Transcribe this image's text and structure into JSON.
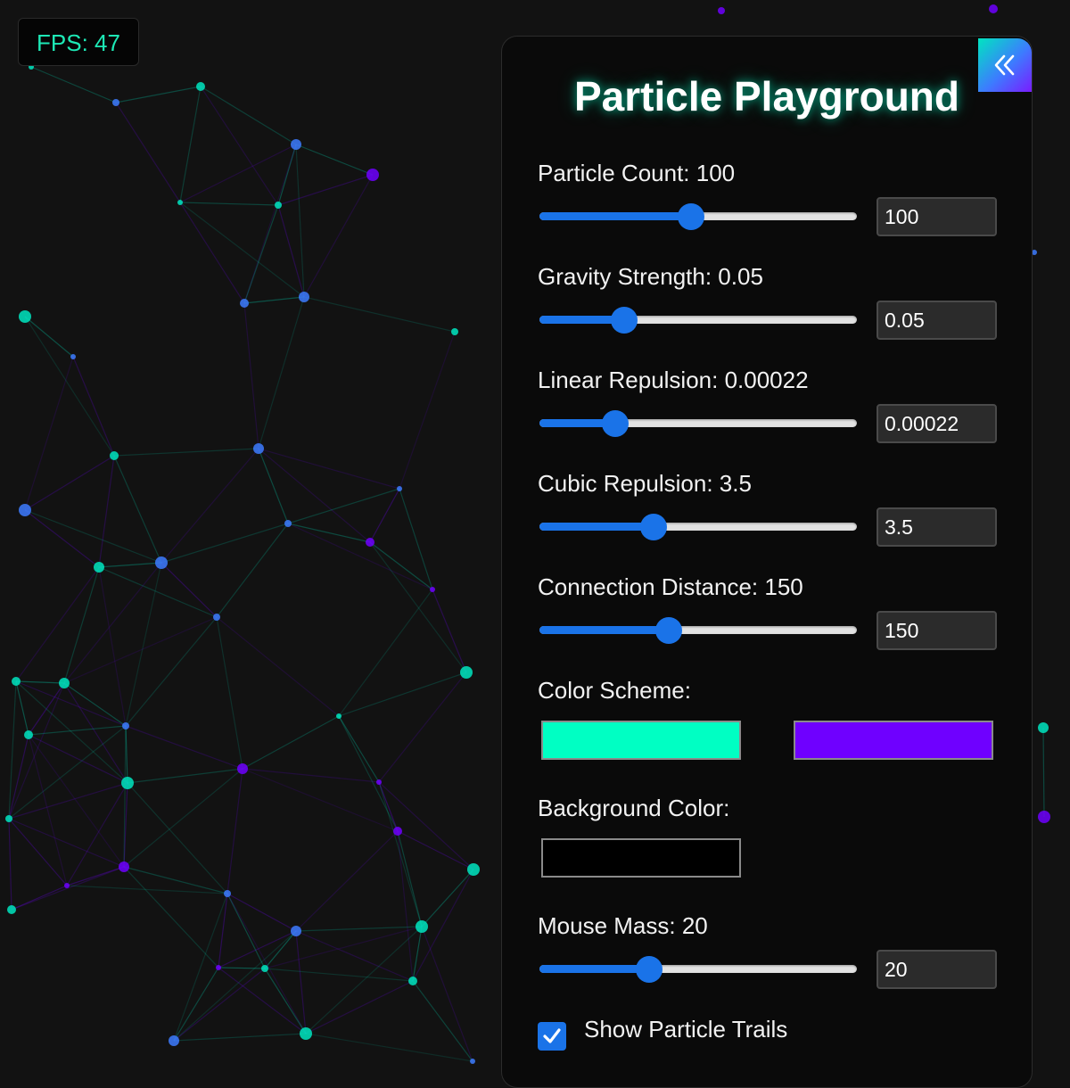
{
  "fps": {
    "text": "FPS: 47"
  },
  "panel": {
    "title": "Particle Playground",
    "collapse_icon": "double-chevron-left-icon",
    "controls": [
      {
        "label": "Particle Count: 100",
        "value": "100",
        "fraction": 0.477
      },
      {
        "label": "Gravity Strength: 0.05",
        "value": "0.05",
        "fraction": 0.268
      },
      {
        "label": "Linear Repulsion: 0.00022",
        "value": "0.00022",
        "fraction": 0.24
      },
      {
        "label": "Cubic Repulsion: 3.5",
        "value": "3.5",
        "fraction": 0.36
      },
      {
        "label": "Connection Distance: 150",
        "value": "150",
        "fraction": 0.407
      }
    ],
    "color_scheme": {
      "label": "Color Scheme:",
      "color1": "#00ffc3",
      "color2": "#6f00ff"
    },
    "background_color": {
      "label": "Background Color:",
      "color": "#000000"
    },
    "mouse_mass": {
      "label": "Mouse Mass: 20",
      "value": "20",
      "fraction": 0.345
    },
    "trails": {
      "label": "Show Particle Trails",
      "checked": true
    }
  },
  "colors": {
    "accent": "#1a73e8",
    "fps_text": "#1de9b6",
    "node_teal": "#00e5c0",
    "node_purple": "#6f00ff",
    "node_blue": "#3d7bff",
    "background": "#121212"
  }
}
